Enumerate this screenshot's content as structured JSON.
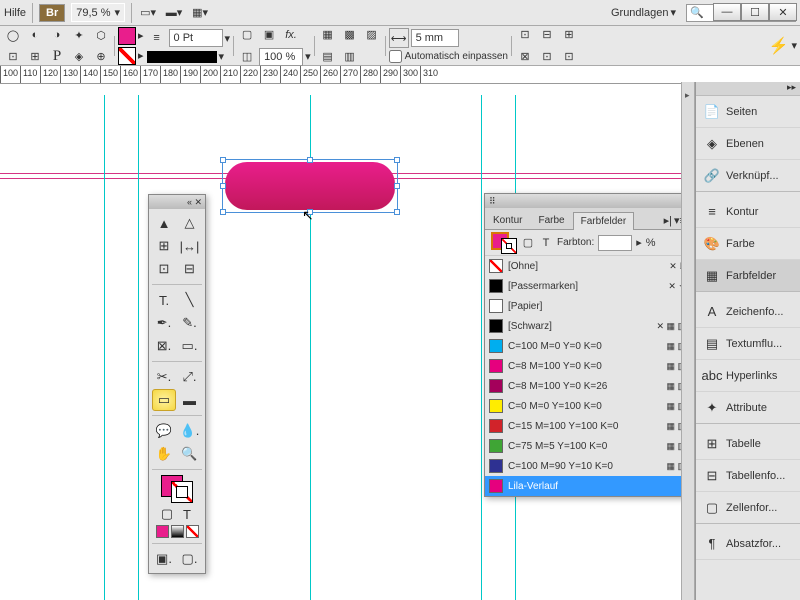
{
  "menu": {
    "help": "Hilfe"
  },
  "workspace": {
    "name": "Grundlagen"
  },
  "zoom": "79,5 %",
  "bridge_label": "Br",
  "stroke": {
    "weight": "0 Pt",
    "scale": "100 %",
    "gap": "5 mm"
  },
  "autofit": "Automatisch einpassen",
  "ruler": [
    "100",
    "110",
    "120",
    "130",
    "140",
    "150",
    "160",
    "170",
    "180",
    "190",
    "200",
    "210",
    "220",
    "230",
    "240",
    "250",
    "260",
    "270",
    "280",
    "290",
    "300",
    "310"
  ],
  "swatch_tabs": [
    "Kontur",
    "Farbe",
    "Farbfelder"
  ],
  "tint": {
    "label": "Farbton:",
    "unit": "%"
  },
  "swatches": [
    {
      "name": "[Ohne]",
      "color": "none",
      "icons": "✕ ⃠"
    },
    {
      "name": "[Passermarken]",
      "color": "#000",
      "icons": "✕ ✦"
    },
    {
      "name": "[Papier]",
      "color": "#fff",
      "icons": ""
    },
    {
      "name": "[Schwarz]",
      "color": "#000",
      "icons": "✕ ▦ ▥"
    },
    {
      "name": "C=100 M=0 Y=0 K=0",
      "color": "#00AEEF",
      "icons": "▦ ▥"
    },
    {
      "name": "C=8 M=100 Y=0 K=0",
      "color": "#E6007E",
      "icons": "▦ ▥"
    },
    {
      "name": "C=8 M=100 Y=0 K=26",
      "color": "#A4005B",
      "icons": "▦ ▥"
    },
    {
      "name": "C=0 M=0 Y=100 K=0",
      "color": "#FFED00",
      "icons": "▦ ▥"
    },
    {
      "name": "C=15 M=100 Y=100 K=0",
      "color": "#D1232A",
      "icons": "▦ ▥"
    },
    {
      "name": "C=75 M=5 Y=100 K=0",
      "color": "#3FA535",
      "icons": "▦ ▥"
    },
    {
      "name": "C=100 M=90 Y=10 K=0",
      "color": "#2E3192",
      "icons": "▦ ▥"
    },
    {
      "name": "Lila-Verlauf",
      "color": "#E6007E",
      "icons": "",
      "selected": true
    }
  ],
  "right_panels": [
    {
      "label": "Seiten",
      "icon": "📄"
    },
    {
      "label": "Ebenen",
      "icon": "◈"
    },
    {
      "label": "Verknüpf...",
      "icon": "🔗",
      "end": true
    },
    {
      "label": "Kontur",
      "icon": "≡"
    },
    {
      "label": "Farbe",
      "icon": "🎨"
    },
    {
      "label": "Farbfelder",
      "icon": "▦",
      "active": true,
      "end": true
    },
    {
      "label": "Zeichenfo...",
      "icon": "A"
    },
    {
      "label": "Textumflu...",
      "icon": "▤"
    },
    {
      "label": "Hyperlinks",
      "icon": "abc"
    },
    {
      "label": "Attribute",
      "icon": "✦",
      "end": true
    },
    {
      "label": "Tabelle",
      "icon": "⊞"
    },
    {
      "label": "Tabellenfo...",
      "icon": "⊟"
    },
    {
      "label": "Zellenfor...",
      "icon": "▢",
      "end": true
    },
    {
      "label": "Absatzfor...",
      "icon": "¶"
    }
  ]
}
